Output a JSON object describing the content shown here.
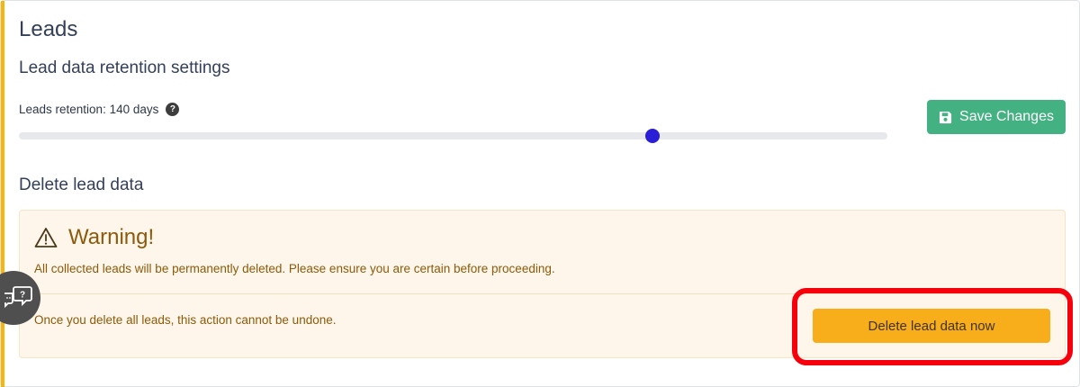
{
  "page": {
    "title": "Leads"
  },
  "retention": {
    "section_title": "Lead data retention settings",
    "label": "Leads retention: 140 days",
    "help_glyph": "?",
    "slider_value_fraction": 0.73,
    "save_label": "Save Changes",
    "save_icon": "floppy-disk-icon",
    "accent_color": "#43b181"
  },
  "delete": {
    "section_title": "Delete lead data",
    "warning_title": "Warning!",
    "warning_icon": "warning-triangle-icon",
    "warning_text": "All collected leads will be permanently deleted. Please ensure you are certain before proceeding.",
    "note": "Once you delete all leads, this action cannot be undone.",
    "button_label": "Delete lead data now",
    "button_color": "#f8ad1a",
    "highlight_color": "#f5000b"
  },
  "widgets": {
    "help_widget_icon": "chat-help-icon"
  }
}
